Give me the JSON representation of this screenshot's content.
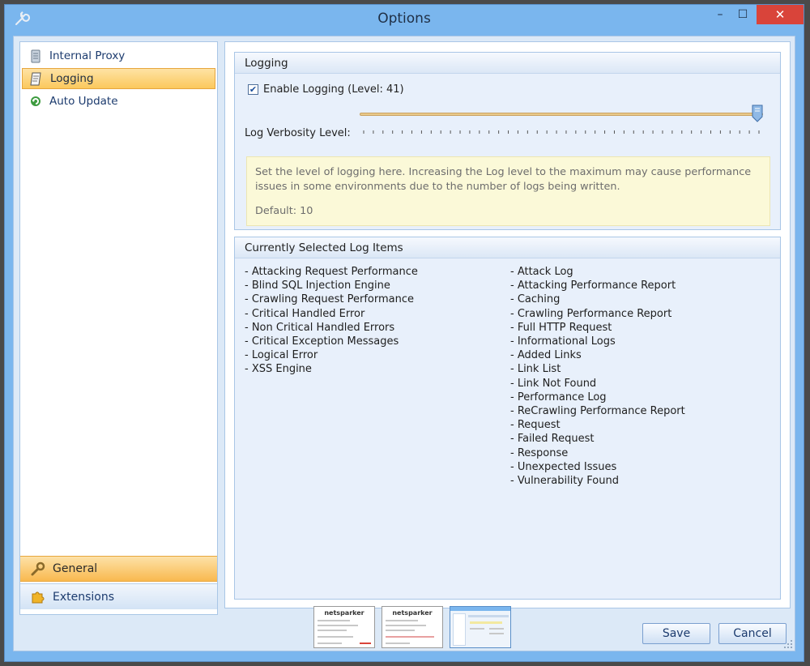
{
  "window": {
    "title": "Options",
    "controls": {
      "minimize": "–",
      "maximize": "☐",
      "close": "✕"
    }
  },
  "nav": {
    "items": [
      {
        "label": "Internal Proxy",
        "icon": "server-icon"
      },
      {
        "label": "Logging",
        "icon": "log-page-icon",
        "selected": true
      },
      {
        "label": "Auto Update",
        "icon": "update-icon"
      }
    ],
    "sections": [
      {
        "label": "General",
        "icon": "wrench-icon",
        "active": true
      },
      {
        "label": "Extensions",
        "icon": "puzzle-icon",
        "active": false
      }
    ]
  },
  "logging_group": {
    "header": "Logging",
    "enable_checkbox": {
      "label": "Enable Logging (Level: 41)",
      "checked": true
    },
    "verbosity": {
      "label": "Log Verbosity Level:",
      "level": 41,
      "max": 41
    },
    "info": {
      "text": "Set the level of logging here. Increasing the Log level to the maximum may cause performance issues in some environments due to the number of logs being written.",
      "default": "Default: 10"
    }
  },
  "log_items_group": {
    "header": "Currently Selected Log Items",
    "left_column": [
      "- Attacking Request Performance",
      "- Blind SQL Injection Engine",
      "- Crawling Request Performance",
      "- Critical Handled Error",
      "- Non Critical Handled Errors",
      "- Critical Exception Messages",
      "- Logical Error",
      "- XSS Engine"
    ],
    "right_column": [
      "- Attack Log",
      "- Attacking Performance Report",
      "- Caching",
      "- Crawling Performance Report",
      "- Full HTTP Request",
      "- Informational Logs",
      "- Added Links",
      "- Link List",
      "- Link Not Found",
      "- Performance Log",
      "- ReCrawling Performance Report",
      "- Request",
      "- Failed Request",
      "- Response",
      "- Unexpected Issues",
      "- Vulnerability Found"
    ]
  },
  "thumbnails": [
    {
      "brand": "netsparker"
    },
    {
      "brand": "netsparker"
    },
    {
      "brand": ""
    }
  ],
  "footer": {
    "save_label": "Save",
    "cancel_label": "Cancel"
  },
  "colors": {
    "accent": "#7ab6ee",
    "selected": "#fbc85c",
    "close": "#d9443a"
  }
}
